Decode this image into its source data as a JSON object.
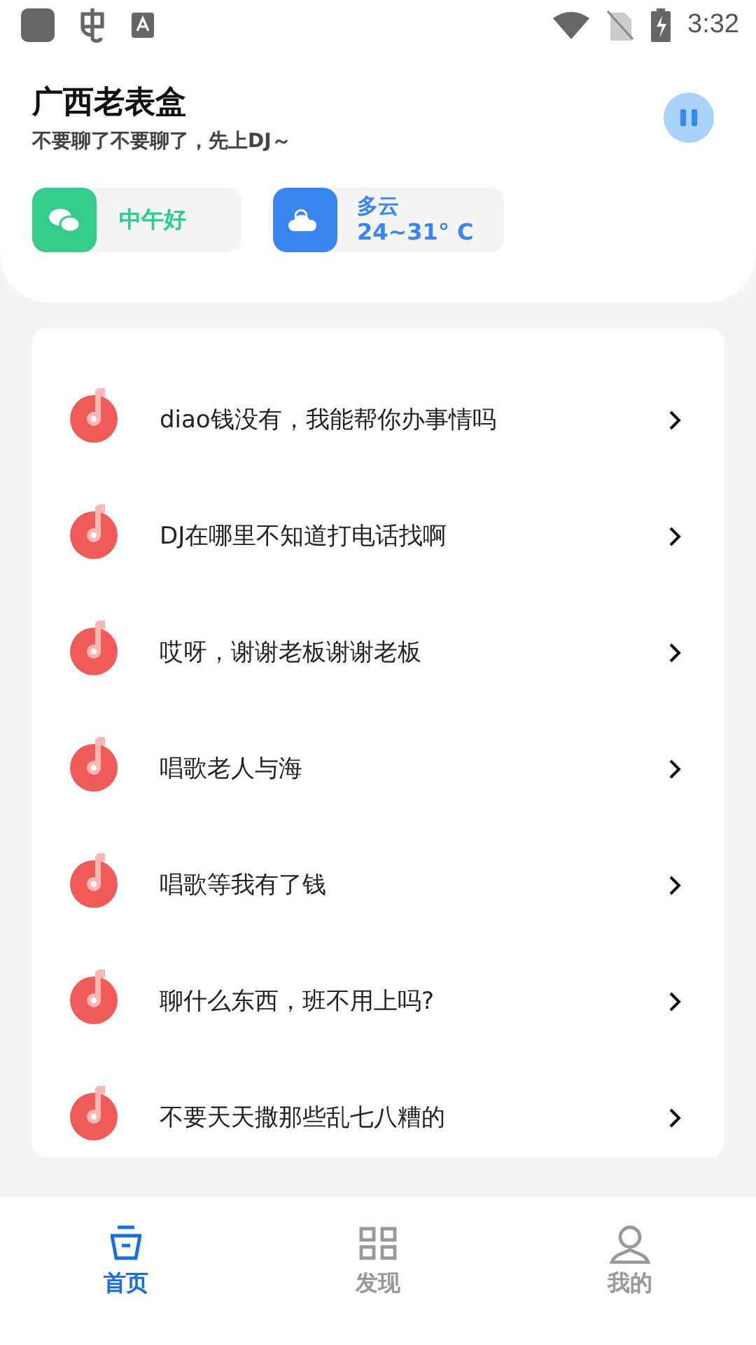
{
  "status_bar": {
    "time": "3:32"
  },
  "header": {
    "title": "广西老表盒",
    "subtitle": "不要聊了不要聊了，先上DJ～",
    "playing": true
  },
  "cards": [
    {
      "kind": "greeting",
      "text": "中午好"
    },
    {
      "kind": "weather",
      "condition": "多云",
      "temperature": "24~31° C"
    }
  ],
  "tracks": [
    {
      "title": "diao钱没有，我能帮你办事情吗"
    },
    {
      "title": "DJ在哪里不知道打电话找啊"
    },
    {
      "title": "哎呀，谢谢老板谢谢老板"
    },
    {
      "title": "唱歌老人与海"
    },
    {
      "title": "唱歌等我有了钱"
    },
    {
      "title": "聊什么东西，班不用上吗?"
    },
    {
      "title": "不要天天撒那些乱七八糟的"
    }
  ],
  "tabs": [
    {
      "label": "首页",
      "kind": "home",
      "selected": true
    },
    {
      "label": "发现",
      "kind": "discover",
      "selected": false
    },
    {
      "label": "我的",
      "kind": "profile",
      "selected": false
    }
  ]
}
